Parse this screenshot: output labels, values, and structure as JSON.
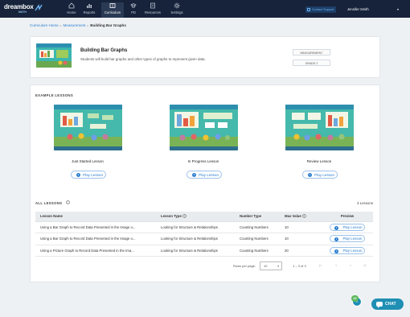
{
  "brand": {
    "name": "dreambox",
    "sub": "MATH"
  },
  "nav": {
    "items": [
      {
        "label": "Home",
        "icon": "home-icon"
      },
      {
        "label": "Reports",
        "icon": "reports-icon"
      },
      {
        "label": "Curriculum",
        "icon": "curriculum-icon",
        "active": true
      },
      {
        "label": "PD",
        "icon": "pd-icon"
      },
      {
        "label": "Resources",
        "icon": "resources-icon"
      },
      {
        "label": "Settings",
        "icon": "settings-icon"
      }
    ],
    "support_label": "Contact Support",
    "user_name": "Jennifer Smith"
  },
  "breadcrumb": {
    "home": "Curriculum Home",
    "section": "Measurement",
    "current": "Building Bar Graphs"
  },
  "lesson": {
    "title": "Building Bar Graphs",
    "description": "Students will build bar graphs and other types of graphs to represent given data.",
    "tags": [
      "MEASUREMENT",
      "GRADE 2"
    ]
  },
  "examples": {
    "title": "EXAMPLE LESSONS",
    "items": [
      {
        "label": "Just Started Lesson",
        "button": "Play Lesson"
      },
      {
        "label": "In Progress Lesson",
        "button": "Play Lesson"
      },
      {
        "label": "Review Lesson",
        "button": "Play Lesson"
      }
    ]
  },
  "all_lessons": {
    "title": "ALL LESSONS",
    "count": "3 Lessons",
    "columns": [
      "Lesson Name",
      "Lesson Type",
      "Number Type",
      "Max Value",
      "Preview"
    ],
    "rows": [
      {
        "name": "Using a Bar Graph to Record Data Presented in the Image o...",
        "type": "Looking for Structure & Relationships",
        "number": "Counting Numbers",
        "max": "10",
        "preview": "Play Lesson"
      },
      {
        "name": "Using a Bar Graph to Record Data Presented in the Image o...",
        "type": "Looking for Structure & Relationships",
        "number": "Counting Numbers",
        "max": "10",
        "preview": "Play Lesson"
      },
      {
        "name": "Using a Picture Graph to Record Data Presented in the Ima...",
        "type": "Looking for Structure & Relationships",
        "number": "Counting Numbers",
        "max": "20",
        "preview": "Play Lesson"
      }
    ],
    "pager": {
      "rows_label": "Rows per page:",
      "rows_value": "10",
      "range": "1 – 3 of 3"
    }
  },
  "widgets": {
    "notif_count": "22",
    "chat_label": "CHAT"
  }
}
